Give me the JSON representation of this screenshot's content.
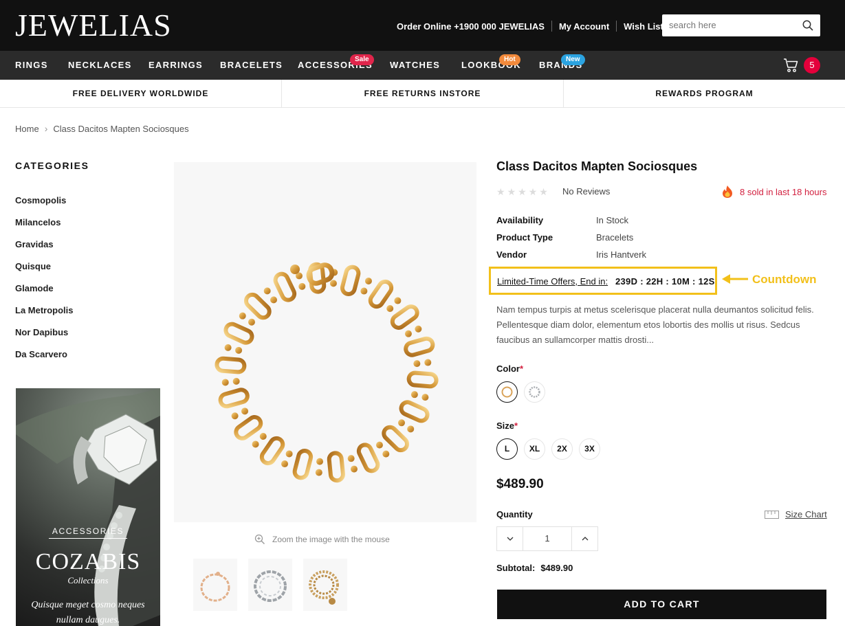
{
  "header": {
    "logo": "JEWELIAS",
    "order_online": "Order Online +1900 000 JEWELIAS",
    "my_account": "My Account",
    "wish_lists": "Wish Lists",
    "search_placeholder": "search here"
  },
  "nav": {
    "items": [
      {
        "label": "RINGS"
      },
      {
        "label": "NECKLACES"
      },
      {
        "label": "EARRINGS"
      },
      {
        "label": "BRACELETS"
      },
      {
        "label": "ACCESSORIES",
        "badge": "Sale",
        "badge_color": "#e0254b"
      },
      {
        "label": "WATCHES"
      },
      {
        "label": "LOOKBOOK",
        "badge": "Hot",
        "badge_color": "#f28a3c"
      },
      {
        "label": "BRANDS",
        "badge": "New",
        "badge_color": "#2ba3e0"
      }
    ],
    "cart_count": "5"
  },
  "benefits": [
    "FREE DELIVERY WORLDWIDE",
    "FREE RETURNS INSTORE",
    "REWARDS PROGRAM"
  ],
  "breadcrumb": {
    "home": "Home",
    "current": "Class Dacitos Mapten Sociosques"
  },
  "sidebar": {
    "title": "CATEGORIES",
    "categories": [
      "Cosmopolis",
      "Milancelos",
      "Gravidas",
      "Quisque",
      "Glamode",
      "La Metropolis",
      "Nor Dapibus",
      "Da Scarvero"
    ],
    "promo": {
      "category": "ACCESSORIES",
      "brand": "COZABIS",
      "subtitle": "Collections",
      "text": "Quisque meget cosmo neques nullam daugues."
    }
  },
  "gallery": {
    "zoom_hint": "Zoom the image with the mouse",
    "thumbnails": [
      "rose-gold-bracelet",
      "silver-bracelet",
      "gold-charm-bracelet"
    ]
  },
  "product": {
    "title": "Class Dacitos Mapten Sociosques",
    "rating": 0,
    "reviews": "No Reviews",
    "sold": "8 sold in last 18 hours",
    "specs": [
      {
        "key": "Availability",
        "value": "In Stock"
      },
      {
        "key": "Product Type",
        "value": "Bracelets"
      },
      {
        "key": "Vendor",
        "value": "Iris Hantverk"
      }
    ],
    "countdown": {
      "label": "Limited-Time Offers, End in:",
      "timer": "239D : 22H : 10M : 12S",
      "annotation": "Countdown"
    },
    "description": "Nam tempus turpis at metus scelerisque placerat nulla deumantos solicitud felis. Pellentesque diam dolor, elementum etos lobortis des mollis ut risus. Sedcus faucibus an sullamcorper mattis drosti...",
    "color_label": "Color",
    "colors": [
      "gold",
      "silver"
    ],
    "size_label": "Size",
    "sizes": [
      "L",
      "XL",
      "2X",
      "3X"
    ],
    "selected_size": "L",
    "price": "$489.90",
    "quantity_label": "Quantity",
    "quantity": "1",
    "size_chart": "Size Chart",
    "subtotal_label": "Subtotal:",
    "subtotal": "$489.90",
    "add_to_cart": "ADD TO CART"
  },
  "colors": {
    "accent_red": "#d2203f",
    "highlight_yellow": "#f2c01a",
    "header_bg": "#111111",
    "nav_bg": "#2b2b2b"
  }
}
